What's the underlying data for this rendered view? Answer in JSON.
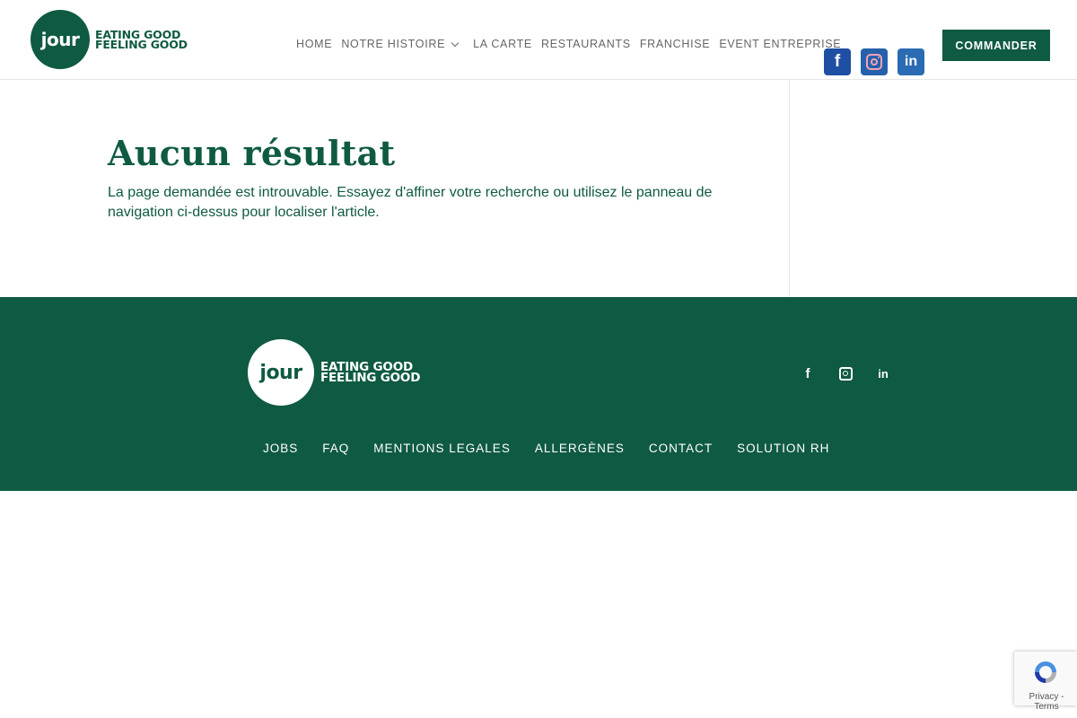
{
  "brand": {
    "logo_word": "jour",
    "tagline_line1": "EATING GOOD",
    "tagline_line2": "FEELING GOOD",
    "primary_color": "#0f5a43"
  },
  "nav": {
    "items": [
      {
        "label": "HOME"
      },
      {
        "label": "NOTRE HISTOIRE"
      },
      {
        "label": "LA CARTE"
      },
      {
        "label": "RESTAURANTS"
      },
      {
        "label": "FRANCHISE"
      },
      {
        "label": "EVENT ENTREPRISE"
      }
    ],
    "social": [
      {
        "icon": "facebook-icon",
        "letter": "f",
        "color": "#1e4fa3"
      },
      {
        "icon": "instagram-icon",
        "color": "#2561ab"
      },
      {
        "icon": "linkedin-icon",
        "letter": "in",
        "color": "#2a6bb3"
      }
    ],
    "cta_label": "COMMANDER"
  },
  "main": {
    "title": "Aucun résultat",
    "message": "La page demandée est introuvable. Essayez d'affiner votre recherche ou utilisez le panneau de navigation ci-dessus pour localiser l'article."
  },
  "footer": {
    "social": [
      {
        "icon": "facebook-icon",
        "letter": "f"
      },
      {
        "icon": "instagram-icon"
      },
      {
        "icon": "linkedin-icon",
        "letter": "in"
      }
    ],
    "links": [
      {
        "label": "JOBS"
      },
      {
        "label": "FAQ"
      },
      {
        "label": "MENTIONS LEGALES"
      },
      {
        "label": "ALLERGÈNES"
      },
      {
        "label": "CONTACT"
      },
      {
        "label": "SOLUTION RH"
      }
    ]
  },
  "recaptcha": {
    "text": "Privacy - Terms"
  }
}
